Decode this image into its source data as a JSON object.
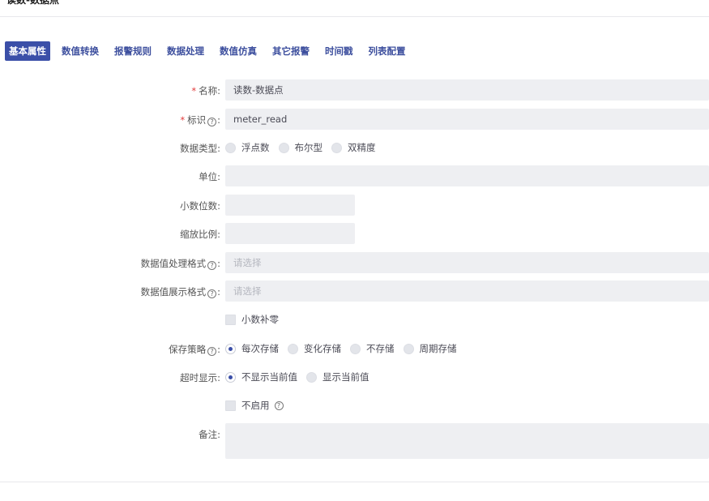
{
  "page": {
    "title": "读数-数据点"
  },
  "tabs": [
    {
      "label": "基本属性",
      "active": true
    },
    {
      "label": "数值转换"
    },
    {
      "label": "报警规则"
    },
    {
      "label": "数据处理"
    },
    {
      "label": "数值仿真"
    },
    {
      "label": "其它报警"
    },
    {
      "label": "时间戳"
    },
    {
      "label": "列表配置"
    }
  ],
  "form": {
    "required_mark": "*",
    "name": {
      "label": "名称:",
      "value": "读数-数据点"
    },
    "identifier": {
      "label": "标识",
      "colon": ":",
      "value": "meter_read"
    },
    "data_type": {
      "label": "数据类型:",
      "options": [
        "浮点数",
        "布尔型",
        "双精度"
      ]
    },
    "unit": {
      "label": "单位:",
      "value": ""
    },
    "decimals": {
      "label": "小数位数:",
      "value": ""
    },
    "scale": {
      "label": "缩放比例:",
      "value": ""
    },
    "process_format": {
      "label": "数据值处理格式",
      "colon": ":",
      "placeholder": "请选择"
    },
    "display_format": {
      "label": "数据值展示格式",
      "colon": ":",
      "placeholder": "请选择"
    },
    "zero_pad": {
      "label": "小数补零",
      "checked": false
    },
    "save_strategy": {
      "label": "保存策略",
      "colon": ":",
      "options": [
        "每次存储",
        "变化存储",
        "不存储",
        "周期存储"
      ],
      "selected": "每次存储"
    },
    "timeout_display": {
      "label": "超时显示:",
      "options": [
        "不显示当前值",
        "显示当前值"
      ],
      "selected": "不显示当前值"
    },
    "disable": {
      "label": "不启用",
      "checked": false
    },
    "remark": {
      "label": "备注:",
      "value": ""
    }
  },
  "icons": {
    "help": "question-circle-icon",
    "help_glyph": "?"
  },
  "colors": {
    "accent": "#3b4fa8",
    "required": "#e23b3b",
    "input_bg": "#eeeff2"
  }
}
